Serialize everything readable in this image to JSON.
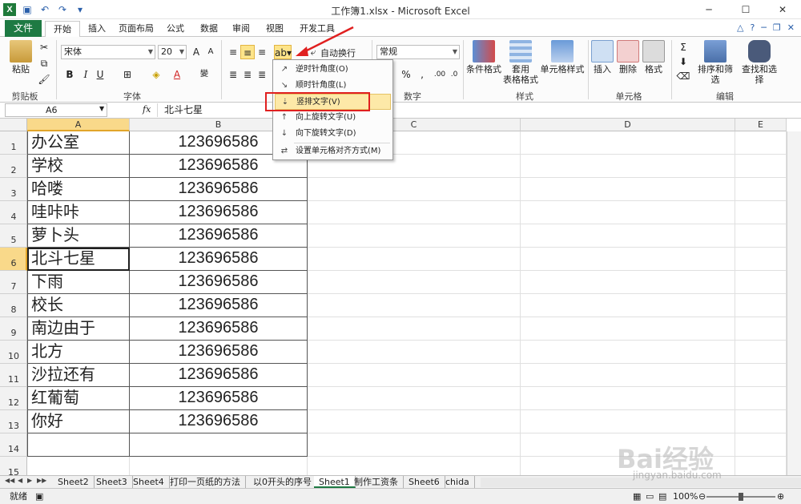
{
  "window": {
    "title": "工作簿1.xlsx - Microsoft Excel",
    "app_letter": "X"
  },
  "tabs": {
    "file": "文件",
    "items": [
      "开始",
      "插入",
      "页面布局",
      "公式",
      "数据",
      "审阅",
      "视图",
      "开发工具"
    ]
  },
  "ribbon": {
    "clipboard": {
      "paste": "粘贴",
      "label": "剪贴板"
    },
    "font": {
      "name": "宋体",
      "size": "20",
      "label": "字体"
    },
    "alignment": {
      "wrap": "自动换行"
    },
    "number": {
      "format": "常规",
      "label": "数字"
    },
    "styles": {
      "cond": "条件格式",
      "table_l1": "套用",
      "table_l2": "表格格式",
      "cell": "单元格样式",
      "label": "样式"
    },
    "cells": {
      "insert": "插入",
      "delete": "删除",
      "format": "格式",
      "label": "单元格"
    },
    "editing": {
      "sort": "排序和筛选",
      "find": "查找和选择",
      "label": "编辑"
    }
  },
  "formula_bar": {
    "name_box": "A6",
    "fx": "fx",
    "value": "北斗七星"
  },
  "orientation_menu": {
    "items": [
      {
        "label": "逆时针角度(O)",
        "icon": "ab-rotate-ccw-icon"
      },
      {
        "label": "顺时针角度(L)",
        "icon": "ab-rotate-cw-icon"
      },
      {
        "label": "竖排文字(V)",
        "icon": "vertical-text-icon"
      },
      {
        "label": "向上旋转文字(U)",
        "icon": "rotate-up-icon"
      },
      {
        "label": "向下旋转文字(D)",
        "icon": "rotate-down-icon"
      },
      {
        "label": "设置单元格对齐方式(M)",
        "icon": "format-alignment-icon"
      }
    ],
    "highlighted_index": 2
  },
  "grid": {
    "columns": [
      "A",
      "B",
      "C",
      "D",
      "E"
    ],
    "selected_col": "A",
    "selected_row": 6,
    "rows": [
      {
        "n": "1",
        "a": "办公室",
        "b": "123696586"
      },
      {
        "n": "2",
        "a": "学校",
        "b": "123696586"
      },
      {
        "n": "3",
        "a": "哈喽",
        "b": "123696586"
      },
      {
        "n": "4",
        "a": "哇咔咔",
        "b": "123696586"
      },
      {
        "n": "5",
        "a": "萝卜头",
        "b": "123696586"
      },
      {
        "n": "6",
        "a": "北斗七星",
        "b": "123696586"
      },
      {
        "n": "7",
        "a": "下雨",
        "b": "123696586"
      },
      {
        "n": "8",
        "a": "校长",
        "b": "123696586"
      },
      {
        "n": "9",
        "a": "南边由于",
        "b": "123696586"
      },
      {
        "n": "10",
        "a": "北方",
        "b": "123696586"
      },
      {
        "n": "11",
        "a": "沙拉还有",
        "b": "123696586"
      },
      {
        "n": "12",
        "a": "红葡萄",
        "b": "123696586"
      },
      {
        "n": "13",
        "a": "你好",
        "b": "123696586"
      },
      {
        "n": "14",
        "a": "",
        "b": ""
      },
      {
        "n": "15",
        "a": "",
        "b": ""
      }
    ]
  },
  "sheets": {
    "tabs": [
      "Sheet2",
      "Sheet3",
      "Sheet4",
      "打印一页纸的方法",
      "以0开头的序号",
      "Sheet1",
      "制作工资条",
      "Sheet6",
      "chida"
    ],
    "active": "Sheet1"
  },
  "status": {
    "ready": "就绪",
    "zoom": "100%"
  },
  "watermark": {
    "main": "Bai经验",
    "sub": "jingyan.baidu.com"
  }
}
